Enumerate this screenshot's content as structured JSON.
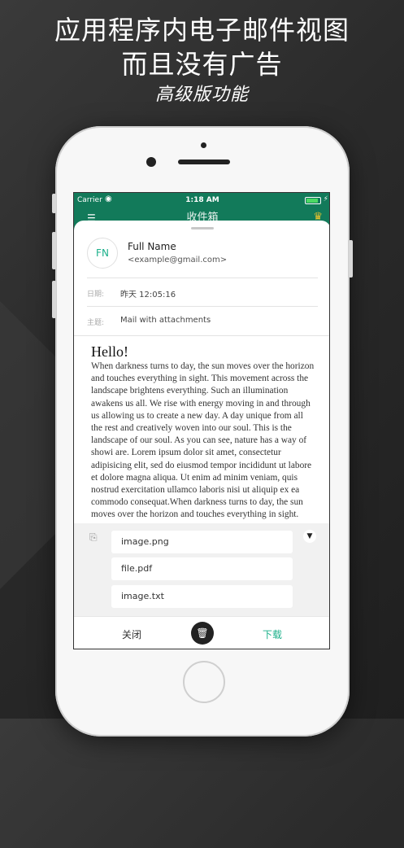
{
  "promo": {
    "line1": "应用程序内电子邮件视图",
    "line2": "而且没有广告",
    "line3": "高级版功能"
  },
  "status_bar": {
    "carrier": "Carrier",
    "time": "1:18 AM"
  },
  "navbar": {
    "title": "收件箱"
  },
  "email": {
    "avatar_initials": "FN",
    "sender_name": "Full Name",
    "sender_email": "<example@gmail.com>",
    "date_label": "日期:",
    "date_value": "昨天 12:05:16",
    "subject_label": "主题:",
    "subject_value": "Mail with attachments",
    "greeting": "Hello!",
    "body": "When darkness turns to day, the sun moves over the horizon and touches everything in sight. This movement across the landscape brightens everything. Such an illumination awakens us all. We rise with energy moving in and through us allowing us to create a new day. A day unique from all the rest and creatively woven into our soul. This is the landscape of our soul. As you can see, nature has a way of showi are. Lorem ipsum dolor sit amet, consectetur adipisicing elit, sed do eiusmod tempor incididunt ut labore et dolore magna aliqua. Ut enim ad minim veniam, quis nostrud exercitation ullamco laboris nisi ut aliquip ex ea commodo consequat.When darkness turns to day, the sun moves over the horizon and touches everything in sight."
  },
  "attachments": [
    "image.png",
    "file.pdf",
    "image.txt"
  ],
  "toolbar": {
    "close_label": "关闭",
    "download_label": "下载"
  },
  "colors": {
    "accent": "#1bb08a",
    "header": "#127a5a"
  }
}
